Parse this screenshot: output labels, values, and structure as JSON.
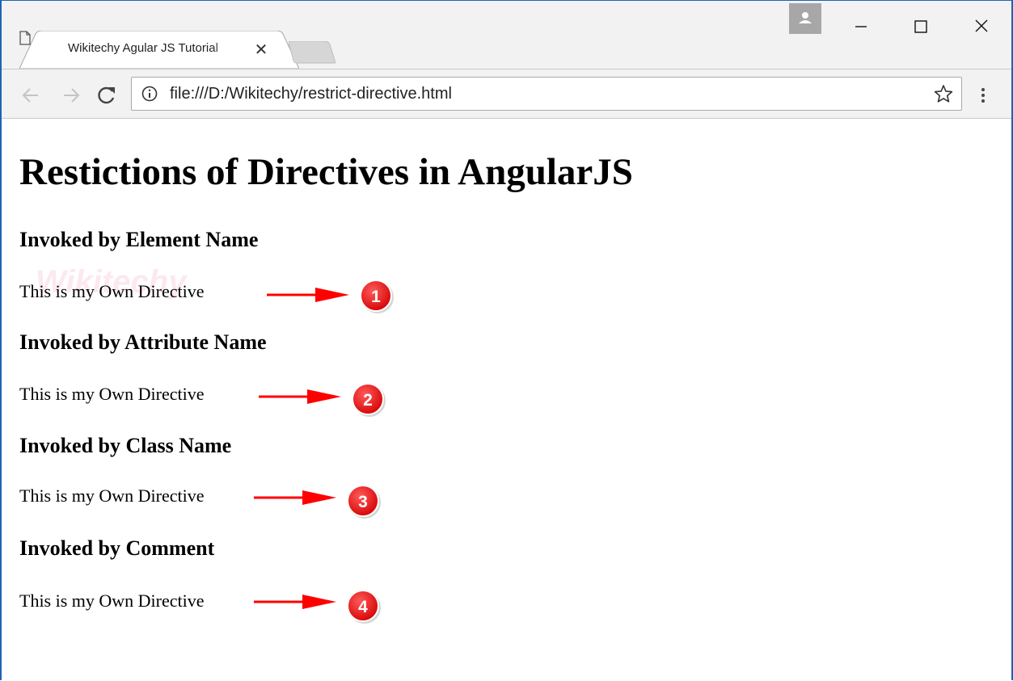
{
  "browser": {
    "tab": {
      "title": "Wikitechy Agular JS Tutorial",
      "close_glyph": "✕"
    },
    "address": {
      "url": "file:///D:/Wikitechy/restrict-directive.html"
    },
    "icons": [
      "page-icon",
      "close-icon",
      "new-tab-icon",
      "profile-icon",
      "minimize-icon",
      "maximize-icon",
      "close-window-icon",
      "back-arrow-icon",
      "forward-arrow-icon",
      "reload-icon",
      "info-icon",
      "star-icon",
      "menu-icon"
    ]
  },
  "page": {
    "heading": "Restictions of Directives in AngularJS",
    "watermark": "Wikitechy",
    "sections": [
      {
        "title": "Invoked by Element Name",
        "text": "This is my Own Directive",
        "badge": "1"
      },
      {
        "title": "Invoked by Attribute Name",
        "text": "This is my Own Directive",
        "badge": "2"
      },
      {
        "title": "Invoked by Class Name",
        "text": "This is my Own Directive",
        "badge": "3"
      },
      {
        "title": "Invoked by Comment",
        "text": "This is my Own Directive",
        "badge": "4"
      }
    ]
  },
  "colors": {
    "frame_accent": "#1e63b5",
    "annotation_red": "#ff0000",
    "badge_red": "#e00000"
  }
}
